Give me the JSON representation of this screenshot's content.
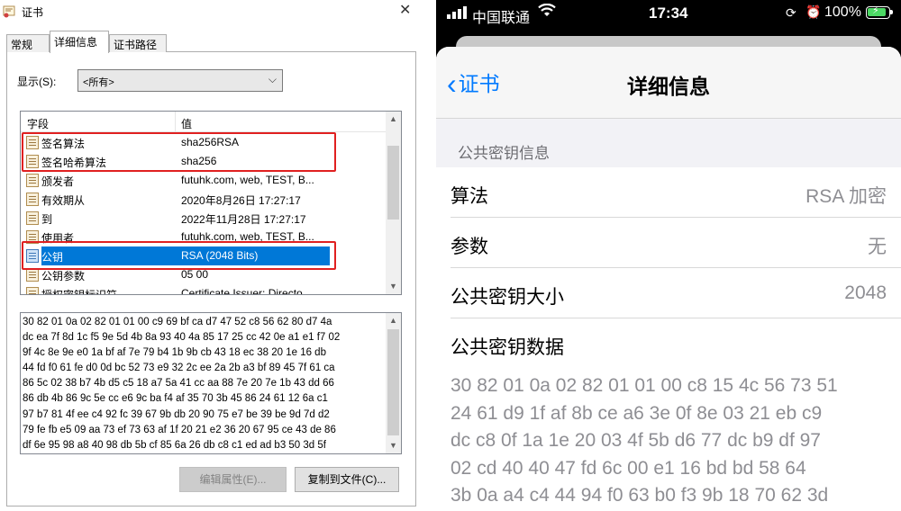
{
  "windows_dialog": {
    "title": "证书",
    "close_glyph": "✕",
    "tabs": [
      {
        "label": "常规"
      },
      {
        "label": "详细信息"
      },
      {
        "label": "证书路径"
      }
    ],
    "show_label": "显示(S):",
    "show_value": "<所有>",
    "columns": {
      "field": "字段",
      "value": "值"
    },
    "rows": [
      {
        "field": "签名算法",
        "value": "sha256RSA"
      },
      {
        "field": "签名哈希算法",
        "value": "sha256"
      },
      {
        "field": "颁发者",
        "value": "futuhk.com, web, TEST, B..."
      },
      {
        "field": "有效期从",
        "value": "2020年8月26日 17:27:17"
      },
      {
        "field": "到",
        "value": "2022年11月28日 17:27:17"
      },
      {
        "field": "使用者",
        "value": "futuhk.com, web, TEST, B..."
      },
      {
        "field": "公钥",
        "value": "RSA (2048 Bits)"
      },
      {
        "field": "公钥参数",
        "value": "05 00"
      },
      {
        "field": "授权密钥标识符",
        "value": "Certificate Issuer: Directo"
      }
    ],
    "selected_row_index": 6,
    "hex_text": "30 82 01 0a 02 82 01 01 00 c9 69 bf ca d7 47 52 c8 56 62 80 d7 4a\ndc ea 7f 8d 1c f5 9e 5d 4b 8a 93 40 4a 85 17 25 cc 42 0e a1 e1 f7 02\n9f 4c 8e 9e e0 1a bf af 7e 79 b4 1b 9b cb 43 18 ec 38 20 1e 16 db\n44 fd f0 61 fe d0 0d bc 52 73 e9 32 2c ee 2a 2b a3 bf 89 45 7f 61 ca\n86 5c 02 38 b7 4b d5 c5 18 a7 5a 41 cc aa 88 7e 20 7e 1b 43 dd 66\n86 db 4b 86 9c 5e cc e6 9c ba f4 af 35 70 3b 45 86 24 61 12 6a c1\n97 b7 81 4f ee c4 92 fc 39 67 9b db 20 90 75 e7 be 39 be 9d 7d d2\n79 fe fb e5 09 aa 73 ef 73 63 af 1f 20 21 e2 36 20 67 95 ce 43 de 86\ndf 6e 95 98 a8 40 98 db 5b cf 85 6a 26 db c8 c1 ed ad b3 50 3d 5f",
    "buttons": {
      "edit": "编辑属性(E)...",
      "copy": "复制到文件(C)..."
    }
  },
  "ios_screen": {
    "status": {
      "carrier": "中国联通",
      "time": "17:34",
      "battery_pct": "100%"
    },
    "nav": {
      "back_label": "证书",
      "title": "详细信息"
    },
    "section_header": "公共密钥信息",
    "cells": [
      {
        "key": "算法",
        "value": "RSA 加密"
      },
      {
        "key": "参数",
        "value": "无"
      },
      {
        "key": "公共密钥大小",
        "value": "2048"
      },
      {
        "key": "公共密钥数据",
        "value": ""
      }
    ],
    "public_key_data": "30 82 01 0a 02 82 01 01 00 c8 15 4c 56 73 51\n24 61 d9 1f af 8b ce a6 3e 0f 8e 03 21 eb c9\ndc c8 0f 1a 1e 20 03 4f 5b d6 77 dc b9 df 97\n02 cd 40 40 47 fd 6c 00 e1 16 bd bd 58 64\n3b 0a a4 c4 44 94 f0 63 b0 f3 9b 18 70 62 3d"
  }
}
